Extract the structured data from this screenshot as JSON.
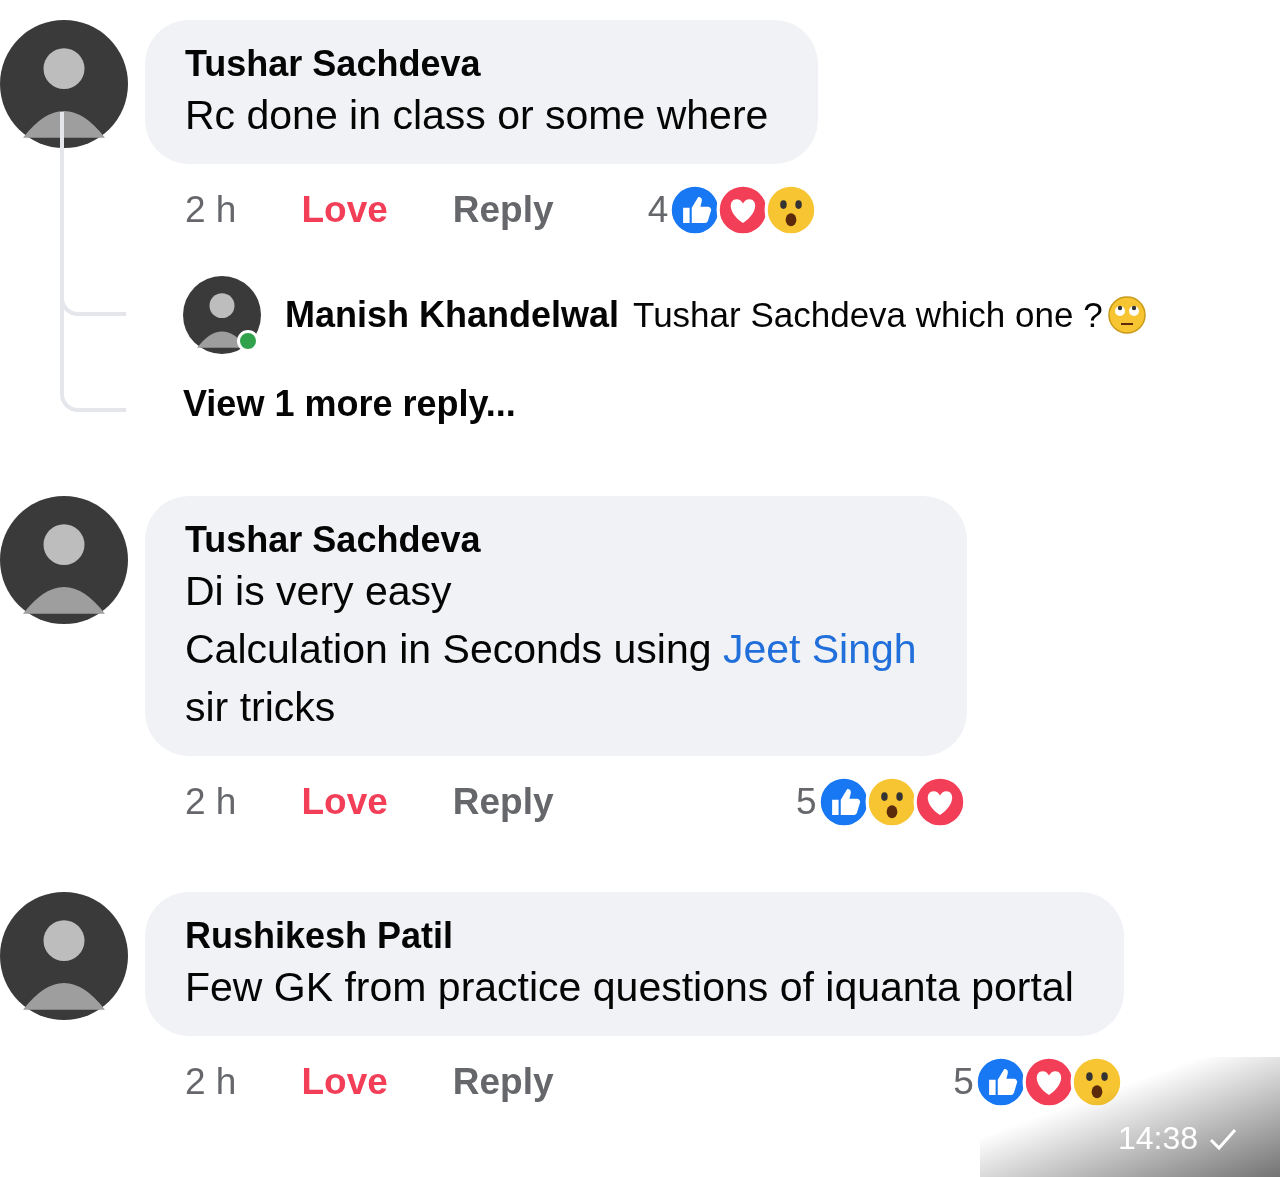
{
  "comments": [
    {
      "author": "Tushar Sachdeva",
      "lines": [
        [
          {
            "kind": "text",
            "text": "Rc done in class or some where"
          }
        ]
      ],
      "time": "2 h",
      "my_reaction": {
        "kind": "love",
        "label": "Love"
      },
      "reply_label": "Reply",
      "reaction_count": "4",
      "reactions": [
        {
          "kind": "like"
        },
        {
          "kind": "love"
        },
        {
          "kind": "wow"
        }
      ],
      "replies": [
        {
          "author": "Manish Khandelwal",
          "text": "Tushar Sachdeva which one ?",
          "online": true
        }
      ],
      "more_replies": "View 1 more reply..."
    },
    {
      "author": "Tushar Sachdeva",
      "lines": [
        [
          {
            "kind": "text",
            "text": "Di is very easy"
          }
        ],
        [
          {
            "kind": "text",
            "text": "Calculation in Seconds using "
          },
          {
            "kind": "link",
            "text": "Jeet Singh"
          }
        ],
        [
          {
            "kind": "text",
            "text": "sir tricks"
          }
        ]
      ],
      "time": "2 h",
      "my_reaction": {
        "kind": "love",
        "label": "Love"
      },
      "reply_label": "Reply",
      "reaction_count": "5",
      "reactions": [
        {
          "kind": "like"
        },
        {
          "kind": "wow"
        },
        {
          "kind": "love"
        }
      ]
    },
    {
      "author": "Rushikesh Patil",
      "lines": [
        [
          {
            "kind": "text",
            "text": "Few GK from practice questions of iquanta portal"
          }
        ]
      ],
      "time": "2 h",
      "my_reaction": {
        "kind": "love",
        "label": "Love"
      },
      "reply_label": "Reply",
      "reaction_count": "5",
      "reactions": [
        {
          "kind": "like"
        },
        {
          "kind": "love"
        },
        {
          "kind": "wow"
        }
      ]
    }
  ],
  "message_meta": {
    "time": "14:38",
    "sent": true
  }
}
